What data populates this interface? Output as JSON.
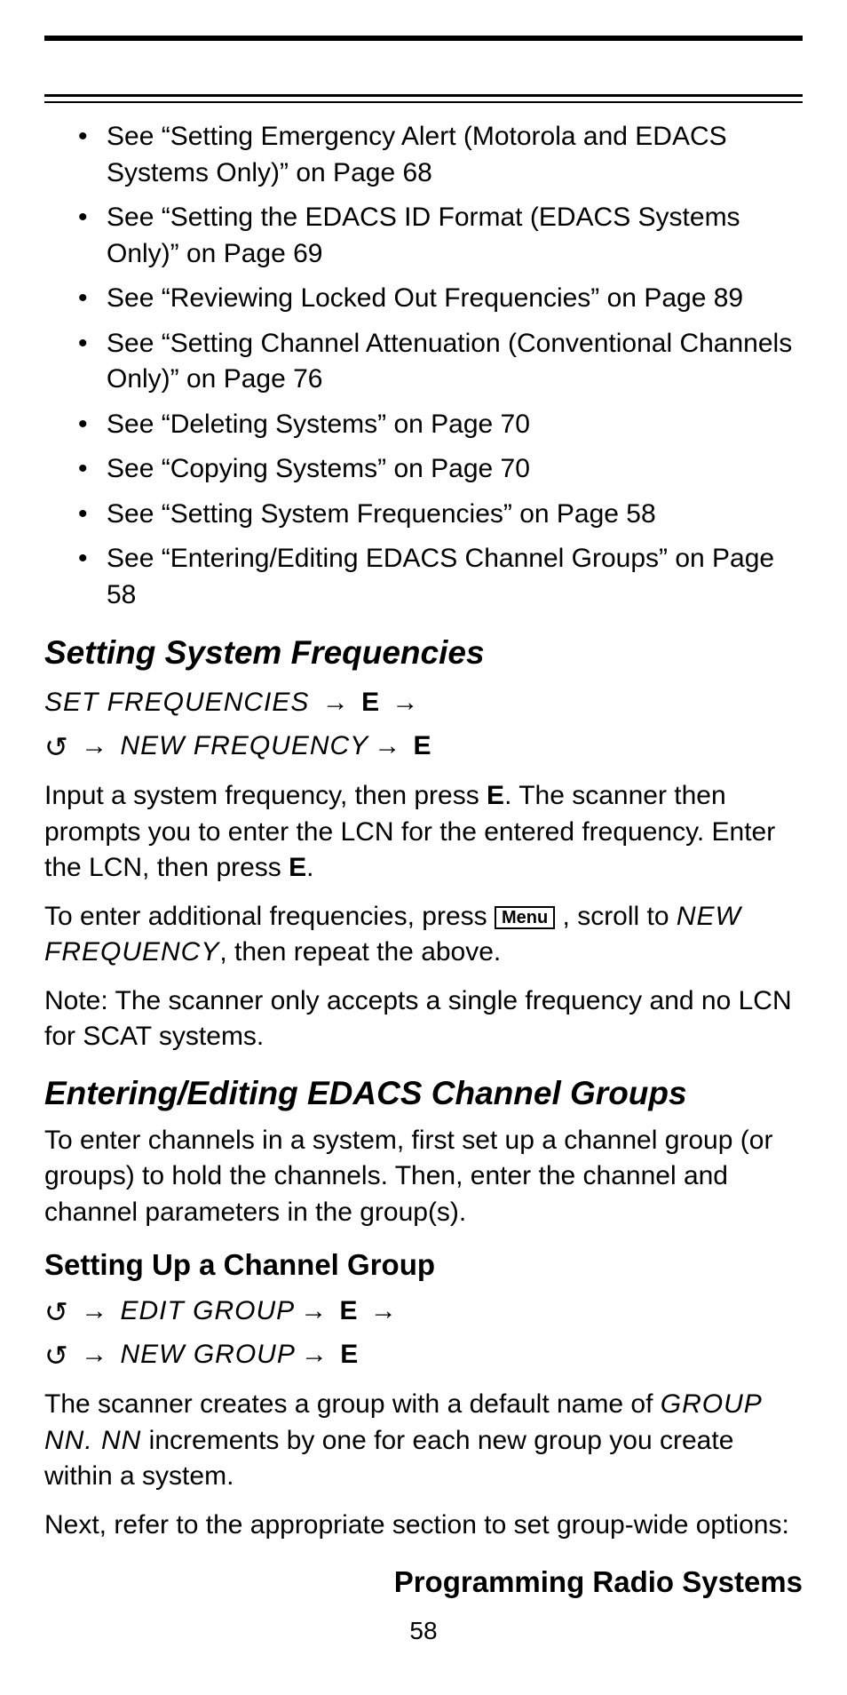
{
  "refs": [
    "See “Setting Emergency Alert (Motorola and EDACS Systems Only)” on Page 68",
    "See “Setting the EDACS ID Format (EDACS Systems Only)” on Page 69",
    "See “Reviewing Locked Out Frequencies” on Page 89",
    "See “Setting Channel Attenuation (Conventional Channels Only)” on Page 76",
    "See “Deleting Systems” on Page 70",
    "See “Copying Systems” on Page 70",
    "See “Setting System Frequencies” on Page 58",
    "See “Entering/Editing EDACS Channel Groups” on Page 58"
  ],
  "section1_title": "Setting System Frequencies",
  "nav1_lcd1": "SET FREQUENCIES",
  "nav1_lcd2": "NEW FREQUENCY",
  "key_e": "E",
  "arrow": "→",
  "rotate": "↺",
  "body1_a": "Input a system frequency, then press ",
  "body1_b": ". The scanner then prompts you to enter the LCN for the entered frequency. Enter the LCN, then press ",
  "body1_c": ".",
  "body2_a": "To enter additional frequencies, press ",
  "body2_menu": "Menu",
  "body2_b": " , scroll to ",
  "body2_lcd": "NEW FREQUENCY",
  "body2_c": ", then repeat the above.",
  "body3": "Note: The scanner only accepts a single frequency and no LCN for SCAT systems.",
  "section2_title": "Entering/Editing EDACS Channel Groups",
  "body4": "To enter channels in a system, first set up a channel group (or groups) to hold the channels. Then, enter the channel and channel parameters in the group(s).",
  "sub1_title": "Setting Up a Channel Group",
  "nav2_lcd1": "EDIT GROUP",
  "nav2_lcd2": "NEW GROUP",
  "body5_a": "The scanner creates a group with a default name of ",
  "body5_lcd": "GROUP NN. NN",
  "body5_b": " increments by one for each new group you create within a system.",
  "body6": "Next, refer to the appropriate section to set group-wide options:",
  "footer_title": "Programming Radio Systems",
  "footer_page": "58"
}
